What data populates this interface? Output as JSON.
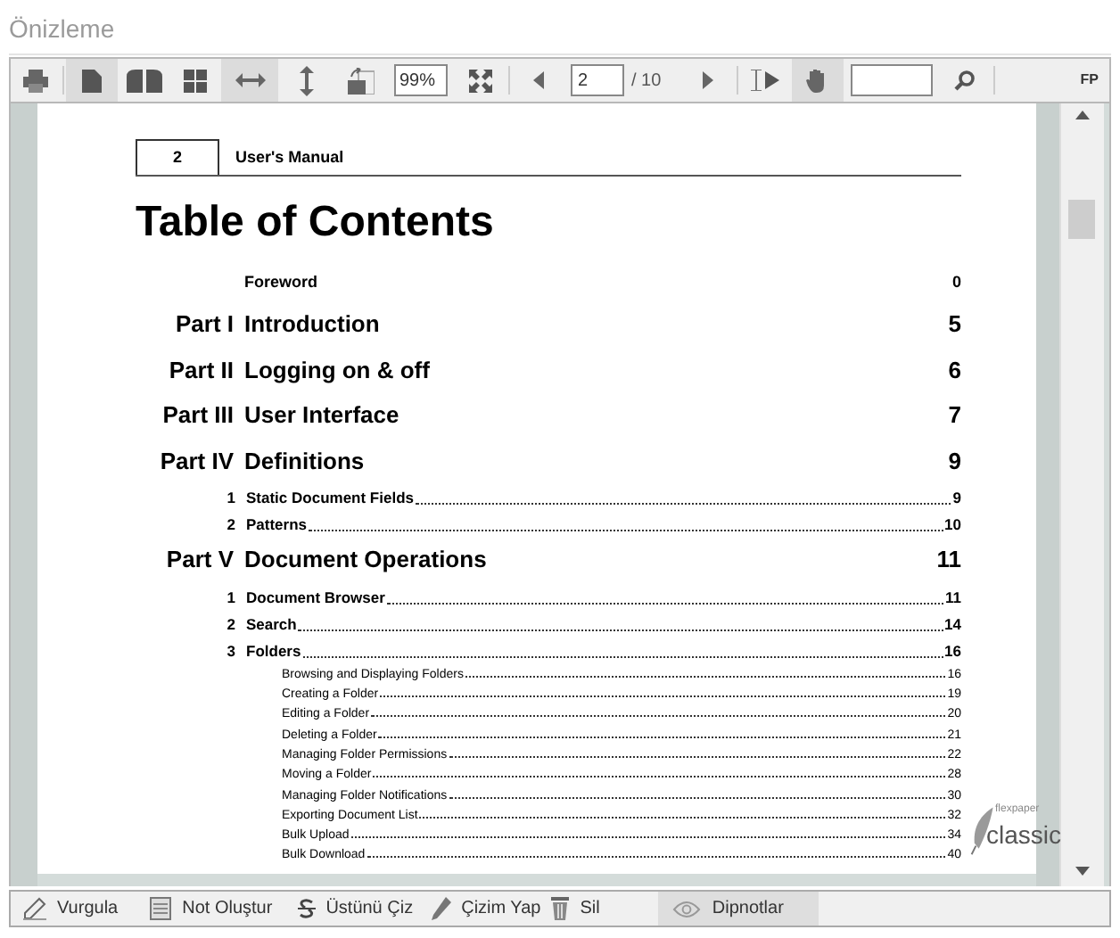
{
  "panel_title": "Önizleme",
  "toolbar": [
    {
      "kind": "print",
      "selected": false
    },
    {
      "kind": "separator"
    },
    {
      "kind": "single-page",
      "selected": true
    },
    {
      "kind": "two-page",
      "selected": false
    },
    {
      "kind": "thumbnails",
      "selected": false
    },
    {
      "kind": "fit-width",
      "selected": true
    },
    {
      "kind": "fit-height",
      "selected": false
    },
    {
      "kind": "rotate",
      "selected": false
    },
    {
      "kind": "zoom-field",
      "value": "99%"
    },
    {
      "kind": "fullscreen",
      "selected": false
    },
    {
      "kind": "separator"
    },
    {
      "kind": "previous",
      "selected": false
    },
    {
      "kind": "page-field",
      "value": "2",
      "total": "/ 10"
    },
    {
      "kind": "next",
      "selected": false
    },
    {
      "kind": "separator"
    },
    {
      "kind": "select-text",
      "selected": false
    },
    {
      "kind": "hand",
      "selected": true
    },
    {
      "kind": "search-field"
    },
    {
      "kind": "search",
      "selected": false
    },
    {
      "kind": "separator"
    },
    {
      "kind": "about",
      "label": "FP"
    }
  ],
  "document_page": {
    "header_number": "2",
    "header_title": "User's Manual",
    "heading": "Table of Contents",
    "entries": [
      {
        "kind": "foreword",
        "title": "Foreword",
        "page": "0"
      },
      {
        "kind": "part",
        "number": "Part I",
        "title": "Introduction",
        "page": "5"
      },
      {
        "kind": "part",
        "number": "Part II",
        "title": "Logging on & off",
        "page": "6"
      },
      {
        "kind": "part",
        "number": "Part III",
        "title": "User Interface",
        "page": "7"
      },
      {
        "kind": "part",
        "number": "Part IV",
        "title": "Definitions",
        "page": "9"
      },
      {
        "kind": "section",
        "number": "1",
        "title": "Static Document Fields",
        "page": "9"
      },
      {
        "kind": "section",
        "number": "2",
        "title": "Patterns",
        "page": "10"
      },
      {
        "kind": "part",
        "number": "Part V",
        "title": "Document Operations",
        "page": "11"
      },
      {
        "kind": "section",
        "number": "1",
        "title": "Document Browser",
        "page": "11"
      },
      {
        "kind": "section",
        "number": "2",
        "title": "Search",
        "page": "14"
      },
      {
        "kind": "section",
        "number": "3",
        "title": "Folders",
        "page": "16"
      },
      {
        "kind": "subsection",
        "title": "Browsing and Displaying Folders",
        "page": "16"
      },
      {
        "kind": "subsection",
        "title": "Creating a Folder",
        "page": "19"
      },
      {
        "kind": "subsection",
        "title": "Editing a Folder",
        "page": "20"
      },
      {
        "kind": "subsection",
        "title": "Deleting a Folder",
        "page": "21"
      },
      {
        "kind": "subsection",
        "title": "Managing Folder Permissions",
        "page": "22"
      },
      {
        "kind": "subsection",
        "title": "Moving a Folder",
        "page": "28"
      },
      {
        "kind": "subsection",
        "title": "Managing Folder Notifications",
        "page": "30"
      },
      {
        "kind": "subsection",
        "title": "Exporting Document List",
        "page": "32"
      },
      {
        "kind": "subsection",
        "title": "Bulk Upload",
        "page": "34"
      },
      {
        "kind": "subsection",
        "title": "Bulk Download",
        "page": "40"
      }
    ]
  },
  "logo": {
    "small": "flexpaper",
    "large": "classic"
  },
  "annotation_bar": [
    {
      "kind": "highlight",
      "label": "Vurgula",
      "selected": false
    },
    {
      "kind": "note",
      "label": "Not Oluştur",
      "selected": false
    },
    {
      "kind": "strikethrough",
      "label": "Üstünü Çiz",
      "selected": false
    },
    {
      "kind": "draw",
      "label": "Çizim Yap",
      "selected": false
    },
    {
      "kind": "delete",
      "label": "Sil",
      "selected": false
    },
    {
      "kind": "footnotes",
      "label": "Dipnotlar",
      "selected": true
    }
  ]
}
